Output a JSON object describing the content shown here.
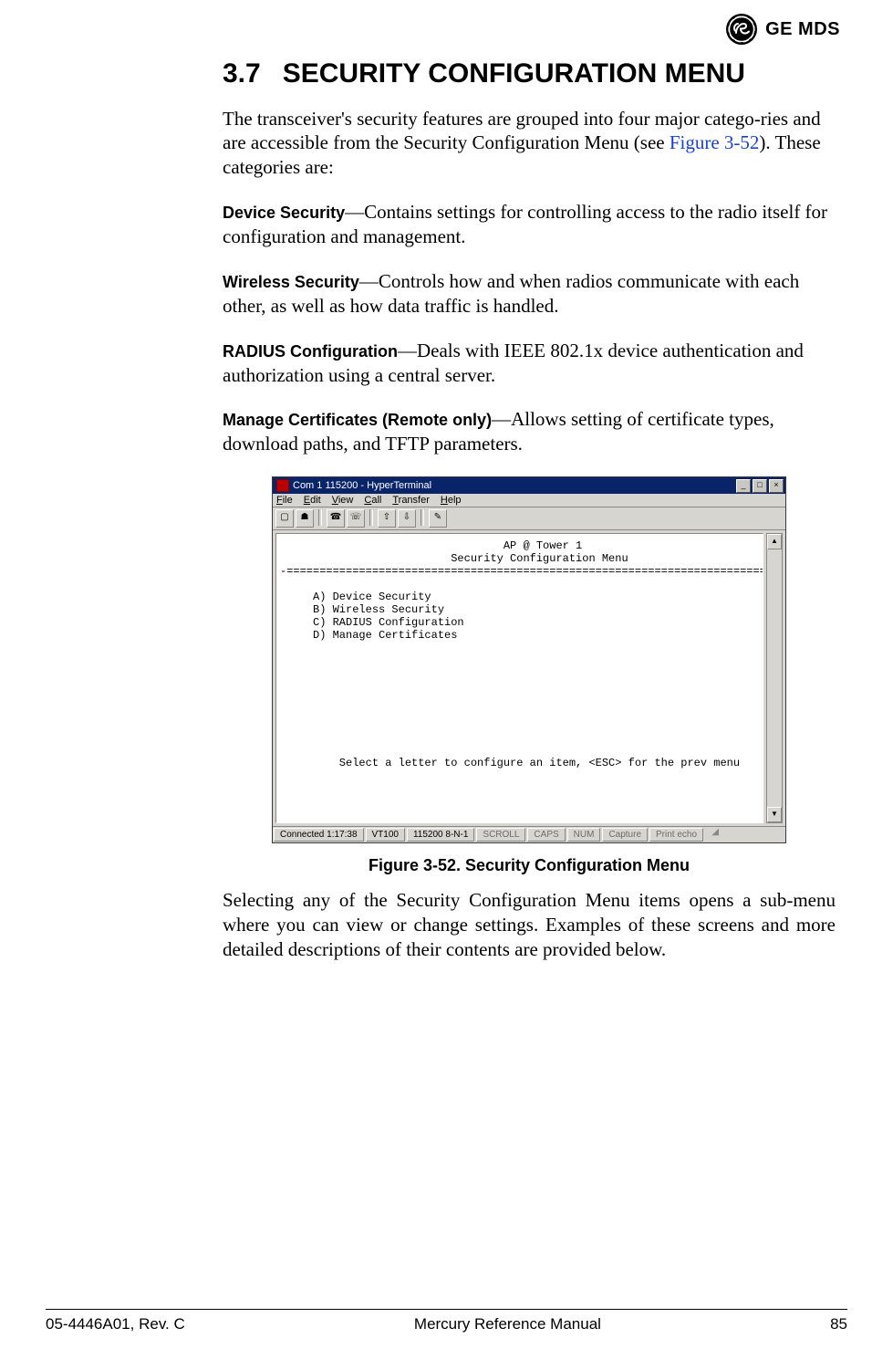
{
  "logo": {
    "brand1": "GE",
    "brand2": "MDS"
  },
  "heading": {
    "number": "3.7",
    "title": "SECURITY CONFIGURATION MENU"
  },
  "intro": {
    "pre": "The transceiver's security features are grouped into four major catego-ries and are accessible from the Security Configuration Menu (see ",
    "xref": "Figure 3-52",
    "post": "). These categories are:"
  },
  "items": [
    {
      "term": "Device Security",
      "desc": "—Contains settings for controlling access to the radio itself for configuration and management."
    },
    {
      "term": "Wireless Security",
      "desc": "—Controls how and when radios communicate with each other, as well as how data traffic is handled."
    },
    {
      "term": "RADIUS Configuration",
      "desc": "—Deals with IEEE 802.1x device authentication and authorization using a central server."
    },
    {
      "term": "Manage Certificates (Remote only)",
      "desc": "—Allows setting of certificate types, download paths, and TFTP parameters."
    }
  ],
  "hyperterm": {
    "title": "Com 1 115200 - HyperTerminal",
    "menus": [
      "File",
      "Edit",
      "View",
      "Call",
      "Transfer",
      "Help"
    ],
    "terminal": {
      "host": "AP @ Tower 1",
      "subtitle": "Security Configuration Menu",
      "divider": "-==============================================================================-",
      "options": [
        "A) Device Security",
        "B) Wireless Security",
        "C) RADIUS Configuration",
        "D) Manage Certificates"
      ],
      "prompt": "Select a letter to configure an item, <ESC> for the prev menu"
    },
    "status": {
      "time": "Connected 1:17:38",
      "emu": "VT100",
      "port": "115200 8-N-1",
      "scroll": "SCROLL",
      "caps": "CAPS",
      "num": "NUM",
      "capture": "Capture",
      "echo": "Print echo"
    }
  },
  "caption": "Figure 3-52. Security Configuration Menu",
  "after": "Selecting any of the Security Configuration Menu items opens a sub-menu where you can view or change settings. Examples of these screens and more detailed descriptions of their contents are provided below.",
  "footer": {
    "left": "05-4446A01, Rev. C",
    "center": "Mercury Reference Manual",
    "right": "85"
  }
}
